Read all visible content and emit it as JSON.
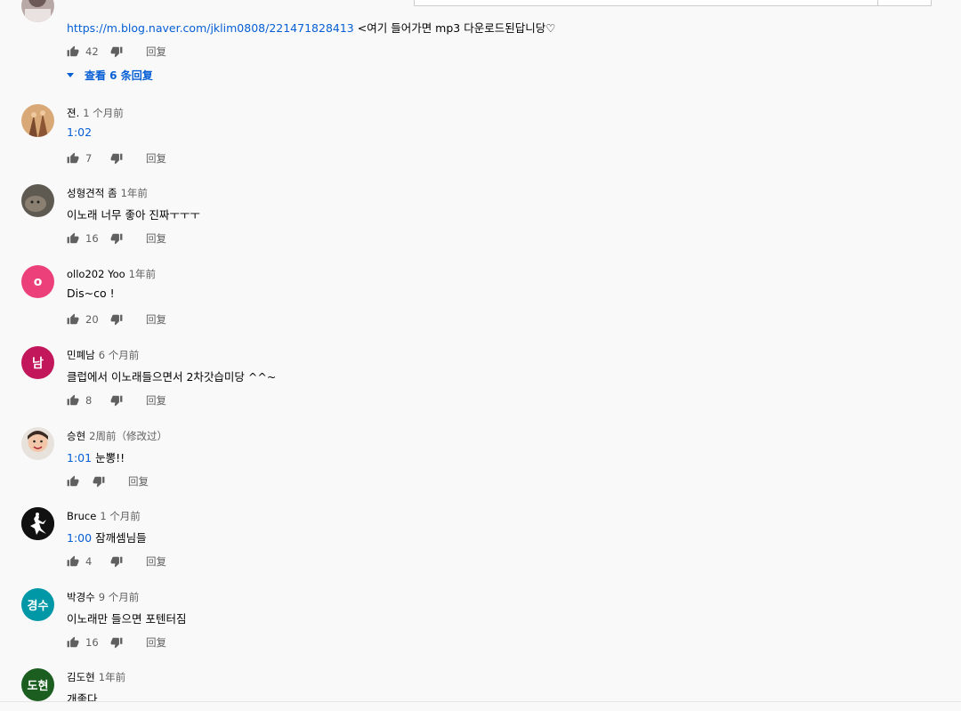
{
  "comments": [
    {
      "author": "",
      "time": "",
      "link": "https://m.blog.naver.com/jklim0808/221471828413",
      "text": "<여기 들어가면 mp3 다운로드된답니당♡",
      "likes": "42",
      "reply": "回复",
      "view_replies": "查看 6 条回复",
      "avatar": "photo"
    },
    {
      "author": "젼.",
      "time": "1 个月前",
      "timestamp": "1:02",
      "text": "",
      "likes": "7",
      "reply": "回复",
      "avatar": "photo-hands"
    },
    {
      "author": "성형견적 좀",
      "time": "1年前",
      "text": "이노래 너무 좋아 진짜ㅜㅜㅜ",
      "likes": "16",
      "reply": "回复",
      "avatar": "photo-cat"
    },
    {
      "author": "ollo202 Yoo",
      "time": "1年前",
      "text": "Dis~co !",
      "likes": "20",
      "reply": "回复",
      "avatar_letter": "o",
      "avatar_color": "#ec407a"
    },
    {
      "author": "민폐남",
      "time": "6 个月前",
      "text": "클럽에서 이노래들으면서 2차갓습미당 ^^~",
      "likes": "8",
      "reply": "回复",
      "avatar_letter": "남",
      "avatar_color": "#c2185b"
    },
    {
      "author": "승현",
      "time": "2周前（修改过）",
      "timestamp": "1:01",
      "text": "눈뽕!!",
      "likes": "",
      "reply": "回复",
      "avatar": "photo-face"
    },
    {
      "author": "Bruce",
      "time": "1 个月前",
      "timestamp": "1:00",
      "text": "잠깨셈님들",
      "likes": "4",
      "reply": "回复",
      "avatar": "logo-jumpman"
    },
    {
      "author": "박경수",
      "time": "9 个月前",
      "text": "이노래만 들으면 포텐터짐",
      "likes": "16",
      "reply": "回复",
      "avatar_letter": "경수",
      "avatar_color": "#0097a7"
    },
    {
      "author": "김도현",
      "time": "1年前",
      "text": "개좋다",
      "likes": "",
      "reply": "",
      "avatar_letter": "도현",
      "avatar_color": "#1b5e20"
    }
  ]
}
